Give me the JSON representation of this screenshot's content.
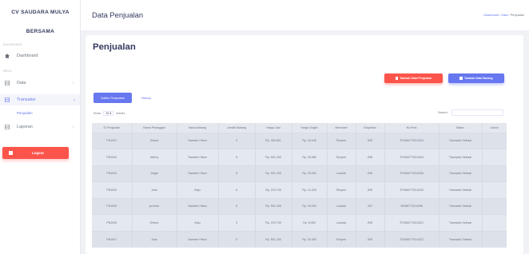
{
  "sidebar": {
    "brand_line1": "CV SAUDARA MULYA",
    "brand_line2": "BERSAMA",
    "section_dashboard": "DASHBOARD",
    "section_menu": "MENU",
    "items": [
      {
        "label": "Dashboard",
        "icon": "home-icon"
      },
      {
        "label": "Data",
        "icon": "grid-icon"
      },
      {
        "label": "Transaksi",
        "icon": "grid-icon"
      },
      {
        "label": "Laporan",
        "icon": "grid-icon"
      }
    ],
    "sub_item": "Penjualan",
    "logout": "Logout"
  },
  "header": {
    "title": "Data Penjualan",
    "breadcrumb": [
      "Dashboard",
      "Data",
      "Penjualan"
    ]
  },
  "content": {
    "heading": "Penjualan",
    "btn_add_sale": "Tambah Data Penjualan",
    "btn_add_item": "Tambah Data Barang",
    "tab_active": "Daftar Penjualan",
    "tab_history": "History",
    "show_label": "Show",
    "show_value": "10",
    "entries_label": "entries",
    "search_label": "Search:"
  },
  "table": {
    "columns": [
      "ID Penjualan",
      "Nama Pelanggan",
      "Nama Barang",
      "Jumlah Barang",
      "Harga Jual",
      "Harga Ongkir",
      "Merchant",
      "Ekspedisi",
      "No Resi",
      "Status",
      "Action"
    ],
    "rows": [
      [
        "PNJ001",
        "Ghana",
        "Sweater Hitam",
        "3",
        "Rp. 300.801",
        "Rp. 18.048",
        "Shopee",
        "JNE",
        "JT0066773314324",
        "Transaksi Selesai",
        ""
      ],
      [
        "PNJ002",
        "Jeffrey",
        "Sweater Hitam",
        "5",
        "Rp. 501.335",
        "Rp. 30.080",
        "Shopee",
        "JNE",
        "JT0066773314325",
        "Transaksi Selesai",
        ""
      ],
      [
        "PNJ003",
        "Jiegar",
        "Sweater Hitam",
        "5",
        "Rp. 501.335",
        "Rp. 25.053",
        "Lazada",
        "JNE",
        "JT0066773314336",
        "Transaksi Selesai",
        ""
      ],
      [
        "PNJ004",
        "Juan",
        "Baju",
        "5",
        "Rp. 223.749",
        "Rp. 13.425",
        "Shopee",
        "JNE",
        "JT0066773314330",
        "Transaksi Selesai",
        ""
      ],
      [
        "PNJ005",
        "pa iman",
        "Sweater Hitam",
        "5",
        "Rp. 501.335",
        "Rp. 25.053",
        "Lazada",
        "J&T",
        "JD066773314356",
        "Transaksi Selesai",
        ""
      ],
      [
        "PNJ006",
        "Ghana",
        "Baju",
        "3",
        "Rp. 223.749",
        "Rp. 8.950",
        "Lazada",
        "JNE",
        "JT0066773314321",
        "Transaksi Selesai",
        ""
      ],
      [
        "PNJ007",
        "Juan",
        "Sweater Hitam",
        "5",
        "Rp. 501.335",
        "Rp. 30.080",
        "Shopee",
        "JNE",
        "JT0066773314322",
        "Transaksi Selesai",
        ""
      ]
    ]
  },
  "colors": {
    "primary": "#6777ef",
    "danger": "#fc544b",
    "text_dark": "#34395e"
  }
}
